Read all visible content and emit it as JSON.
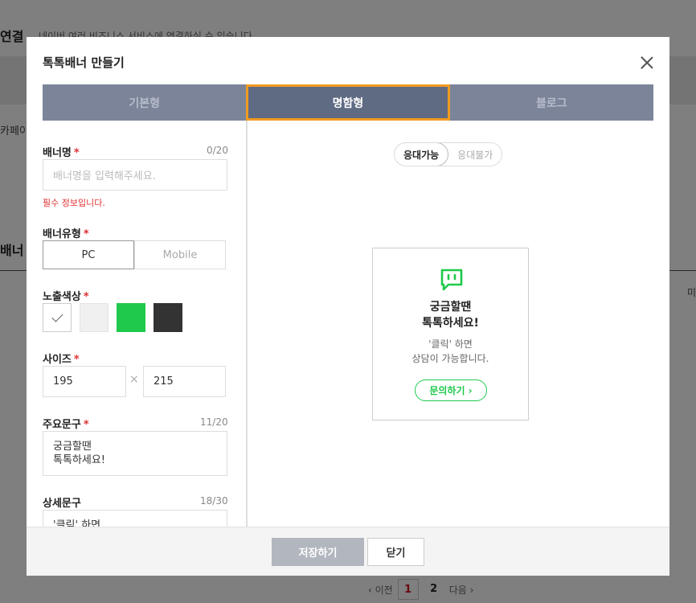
{
  "background": {
    "section_title": "연결",
    "section_subtitle": "네이버 여러 비즈니스 서비스에 연결하실 수 있습니다.",
    "cafe_label": "카페이",
    "banner_heading": "배너 만",
    "right_text": "미",
    "pager": {
      "prev": "‹ 이전",
      "pages": [
        "1",
        "2"
      ],
      "next": "다음 ›"
    }
  },
  "modal": {
    "title": "톡톡배너 만들기",
    "tabs": [
      {
        "label": "기본형"
      },
      {
        "label": "명함형"
      },
      {
        "label": "블로그"
      }
    ],
    "form": {
      "banner_name": {
        "label": "배너명",
        "required": "*",
        "count": "0/20",
        "placeholder": "배너명을 입력해주세요.",
        "error": "필수 정보입니다."
      },
      "banner_type": {
        "label": "배너유형",
        "required": "*",
        "options": [
          "PC",
          "Mobile"
        ],
        "selected": "PC"
      },
      "display_color": {
        "label": "노출색상",
        "required": "*",
        "colors": [
          "#ffffff",
          "#f2f2f2",
          "#1ec94b",
          "#333333"
        ],
        "selected": 0
      },
      "size": {
        "label": "사이즈",
        "required": "*",
        "width": "195",
        "height": "215",
        "separator": "×"
      },
      "main_text": {
        "label": "주요문구",
        "required": "*",
        "count": "11/20",
        "value": "궁금할땐\n톡톡하세요!"
      },
      "detail_text": {
        "label": "상세문구",
        "count": "18/30",
        "value": "'클릭' 하면\n상담이 가능합니다."
      }
    },
    "preview": {
      "toggle": [
        "응대가능",
        "응대불가"
      ],
      "banner": {
        "main": "궁금할땐\n톡톡하세요!",
        "desc": "'클릭' 하면\n상담이 가능합니다.",
        "button": "문의하기 ›"
      }
    },
    "footer": {
      "save": "저장하기",
      "close": "닫기"
    }
  }
}
